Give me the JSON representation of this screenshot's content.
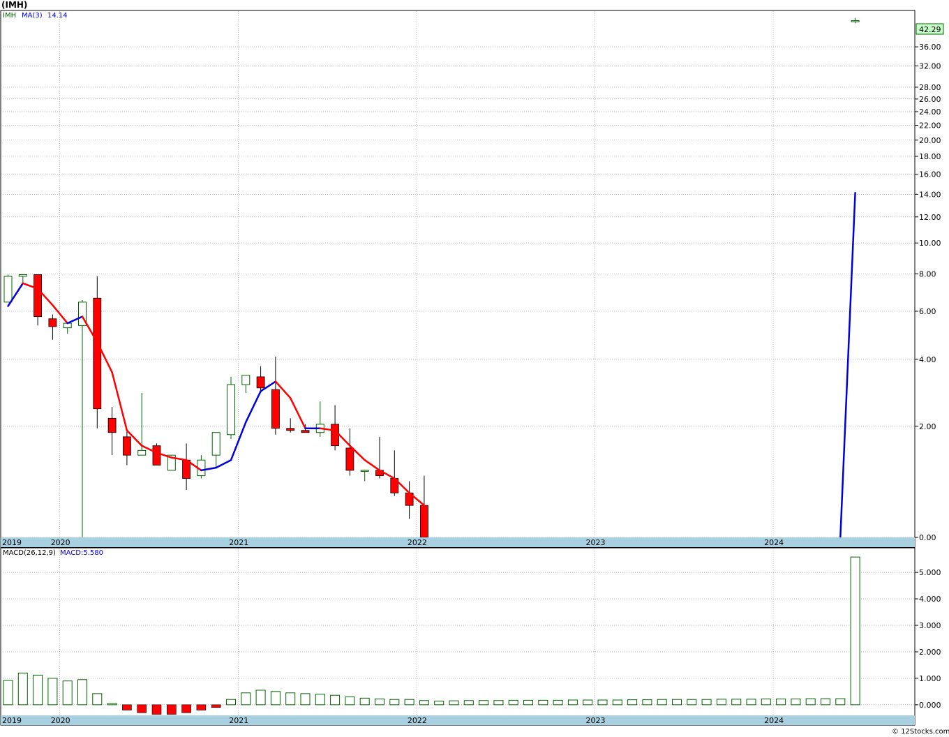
{
  "header": {
    "title": "(IMH)",
    "legend_ticker": "IMH",
    "legend_ma_label": "MA(3)",
    "legend_ma_value": "14.14",
    "last_price_badge": "42.29"
  },
  "macd_header": {
    "label": "MACD(26,12,9)",
    "value": "MACD:5.580"
  },
  "footer": {
    "credit": "© 12Stocks.com"
  },
  "colors": {
    "up": "#006400",
    "down": "#ff0000",
    "ma_up": "#0000dd",
    "ma_down": "#ff0000",
    "axis_band": "#a8d0e0",
    "badge_bg": "#c8ffc8",
    "grid": "#aaaaaa"
  },
  "chart_data": [
    {
      "type": "candlestick",
      "scale": "log",
      "ylim": [
        0,
        45
      ],
      "y_ticks": [
        "0.00",
        "2.00",
        "4.00",
        "6.00",
        "8.00",
        "10.00",
        "12.00",
        "14.00",
        "16.00",
        "18.00",
        "20.00",
        "22.00",
        "24.00",
        "26.00",
        "28.00",
        "32.00",
        "36.00"
      ],
      "x_tick_labels": [
        "2019",
        "2020",
        "2021",
        "2022",
        "2023",
        "2024"
      ],
      "ma_label": "MA(3)",
      "candles": [
        {
          "o": 6.45,
          "h": 7.95,
          "l": 6.45,
          "c": 7.85
        },
        {
          "o": 7.85,
          "h": 7.95,
          "l": 7.45,
          "c": 7.95
        },
        {
          "o": 7.95,
          "h": 7.95,
          "l": 5.35,
          "c": 5.75
        },
        {
          "o": 5.65,
          "h": 5.85,
          "l": 4.75,
          "c": 5.3
        },
        {
          "o": 5.25,
          "h": 5.45,
          "l": 5.0,
          "c": 5.45
        },
        {
          "o": 5.35,
          "h": 6.55,
          "l": 0.0,
          "c": 6.45
        },
        {
          "o": 6.65,
          "h": 7.85,
          "l": 1.95,
          "c": 2.45
        },
        {
          "o": 2.2,
          "h": 2.5,
          "l": 1.35,
          "c": 1.85
        },
        {
          "o": 1.75,
          "h": 1.9,
          "l": 1.15,
          "c": 1.35
        },
        {
          "o": 1.35,
          "h": 2.9,
          "l": 1.35,
          "c": 1.45
        },
        {
          "o": 1.55,
          "h": 1.6,
          "l": 1.15,
          "c": 1.15
        },
        {
          "o": 1.05,
          "h": 1.35,
          "l": 1.05,
          "c": 1.35
        },
        {
          "o": 1.25,
          "h": 1.6,
          "l": 0.7,
          "c": 0.9
        },
        {
          "o": 0.95,
          "h": 1.35,
          "l": 0.9,
          "c": 1.25
        },
        {
          "o": 1.35,
          "h": 1.85,
          "l": 1.1,
          "c": 1.85
        },
        {
          "o": 1.8,
          "h": 3.4,
          "l": 1.7,
          "c": 3.15
        },
        {
          "o": 3.15,
          "h": 3.4,
          "l": 2.9,
          "c": 3.45
        },
        {
          "o": 3.4,
          "h": 3.75,
          "l": 2.95,
          "c": 3.05
        },
        {
          "o": 3.0,
          "h": 4.1,
          "l": 1.8,
          "c": 1.95
        },
        {
          "o": 1.95,
          "h": 2.2,
          "l": 1.85,
          "c": 1.9
        },
        {
          "o": 1.9,
          "h": 2.05,
          "l": 1.85,
          "c": 1.85
        },
        {
          "o": 1.85,
          "h": 2.65,
          "l": 1.75,
          "c": 2.05
        },
        {
          "o": 2.05,
          "h": 2.55,
          "l": 1.45,
          "c": 1.55
        },
        {
          "o": 1.5,
          "h": 1.95,
          "l": 0.95,
          "c": 1.05
        },
        {
          "o": 1.05,
          "h": 1.05,
          "l": 0.85,
          "c": 1.05
        },
        {
          "o": 1.05,
          "h": 1.75,
          "l": 0.9,
          "c": 0.95
        },
        {
          "o": 0.9,
          "h": 1.45,
          "l": 0.6,
          "c": 0.65
        },
        {
          "o": 0.65,
          "h": 0.85,
          "l": 0.25,
          "c": 0.45
        },
        {
          "o": 0.45,
          "h": 0.95,
          "l": 0.0,
          "c": 0.0
        },
        null,
        null,
        null,
        null,
        null,
        null,
        null,
        null,
        null,
        null,
        null,
        null,
        null,
        null,
        null,
        null,
        null,
        null,
        null,
        null,
        null,
        null,
        null,
        null,
        null,
        null,
        null,
        null,
        {
          "o": 42.0,
          "h": 43.0,
          "l": 41.6,
          "c": 42.29
        }
      ],
      "ma": [
        6.25,
        7.45,
        7.15,
        6.3,
        5.45,
        5.75,
        4.65,
        3.55,
        1.9,
        1.55,
        1.4,
        1.3,
        1.25,
        1.05,
        1.1,
        1.25,
        2.1,
        2.95,
        3.25,
        2.75,
        1.95,
        1.95,
        1.9,
        1.55,
        1.25,
        1.05,
        0.9,
        0.65,
        0.45,
        null,
        null,
        null,
        null,
        null,
        null,
        null,
        null,
        null,
        null,
        null,
        null,
        null,
        null,
        null,
        null,
        null,
        null,
        null,
        null,
        null,
        null,
        null,
        null,
        null,
        null,
        null,
        0.0,
        14.14
      ]
    },
    {
      "type": "bar",
      "name": "MACD(26,12,9)",
      "ylim": [
        -0.4,
        5.9
      ],
      "y_ticks": [
        "0.000",
        "1.000",
        "2.000",
        "3.000",
        "4.000",
        "5.000"
      ],
      "x_tick_labels": [
        "2019",
        "2020",
        "2021",
        "2022",
        "2023",
        "2024"
      ],
      "values": [
        0.92,
        1.2,
        1.12,
        1.0,
        0.9,
        0.95,
        0.42,
        0.05,
        -0.2,
        -0.3,
        -0.36,
        -0.36,
        -0.3,
        -0.2,
        -0.1,
        0.2,
        0.45,
        0.55,
        0.5,
        0.45,
        0.42,
        0.4,
        0.36,
        0.3,
        0.25,
        0.22,
        0.2,
        0.2,
        0.16,
        0.14,
        0.15,
        0.16,
        0.16,
        0.16,
        0.17,
        0.17,
        0.17,
        0.17,
        0.18,
        0.18,
        0.18,
        0.18,
        0.19,
        0.19,
        0.2,
        0.2,
        0.2,
        0.2,
        0.21,
        0.21,
        0.21,
        0.22,
        0.22,
        0.22,
        0.23,
        0.23,
        0.23,
        5.58
      ]
    }
  ]
}
